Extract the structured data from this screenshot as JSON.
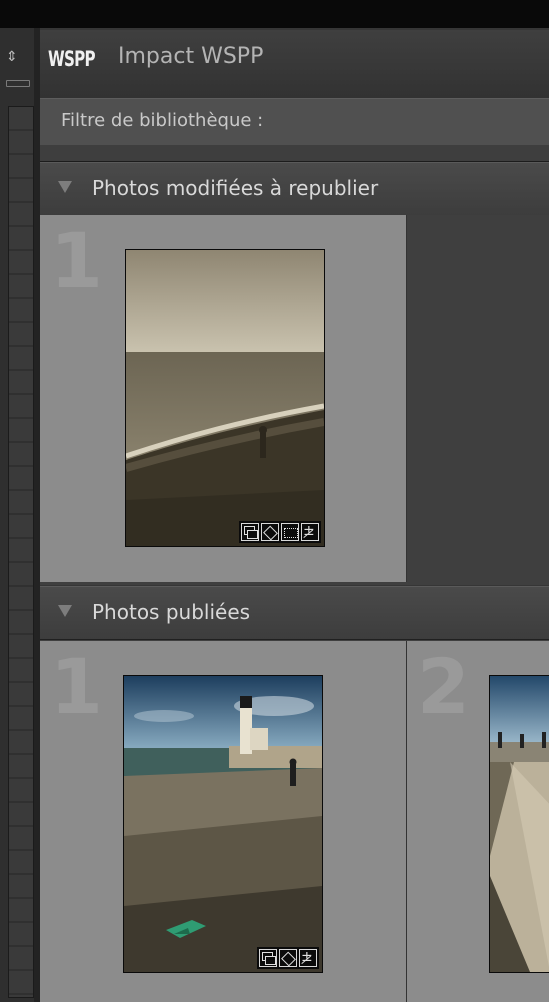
{
  "app": {
    "logo_text": "WSPP",
    "title": "Impact WSPP"
  },
  "filter": {
    "label": "Filtre de bibliothèque :"
  },
  "sections": [
    {
      "title": "Photos modifiées à republier",
      "items": [
        {
          "index": "1",
          "badges": [
            "collection-icon",
            "keyword-icon",
            "crop-icon",
            "edit-icon"
          ]
        }
      ]
    },
    {
      "title": "Photos publiées",
      "items": [
        {
          "index": "1",
          "badges": [
            "collection-icon",
            "keyword-icon",
            "edit-icon"
          ]
        },
        {
          "index": "2",
          "badges": []
        }
      ]
    }
  ]
}
